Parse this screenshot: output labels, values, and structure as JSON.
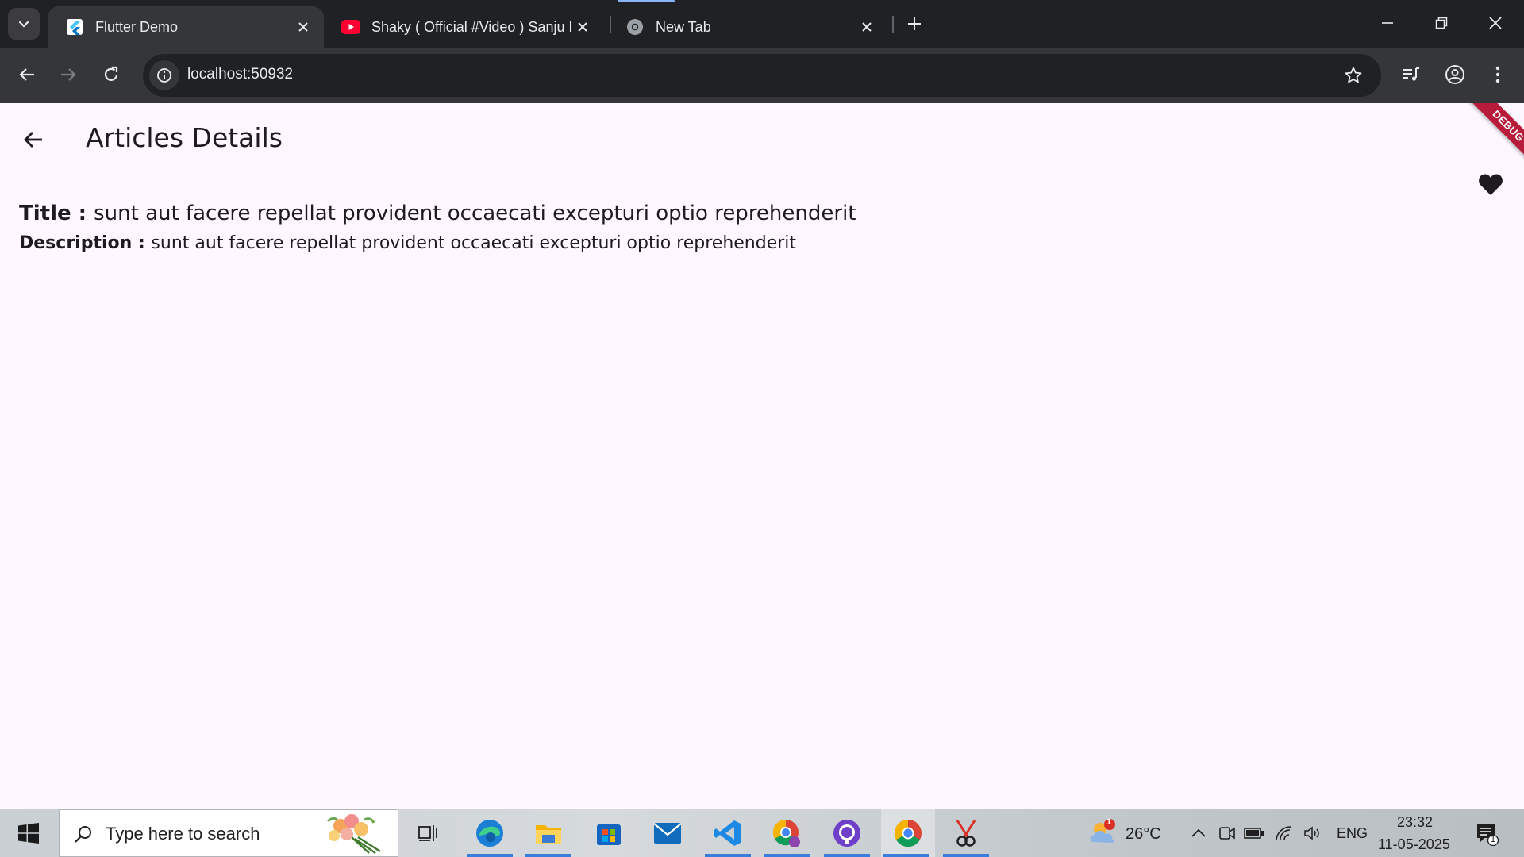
{
  "browser": {
    "tabs": [
      {
        "title": "Flutter Demo",
        "favicon": "flutter-icon",
        "active": true
      },
      {
        "title": "Shaky ( Official #Video ) Sanju R",
        "favicon": "youtube-icon",
        "active": false
      },
      {
        "title": "New Tab",
        "favicon": "chrome-icon",
        "active": false
      }
    ],
    "url": "localhost:50932",
    "colors": {
      "frame": "#202124",
      "toolbar": "#35363a",
      "text": "#e8eaed",
      "loading": "#8ab4f8"
    }
  },
  "app": {
    "appbar_title": "Articles Details",
    "debug_banner": "DEBUG",
    "title_label": "Title : ",
    "title_value": "sunt aut facere repellat provident occaecati excepturi optio reprehenderit",
    "description_label": "Description : ",
    "description_value": "sunt aut facere repellat provident occaecati excepturi optio reprehenderit",
    "favorite_icon": "heart-icon",
    "colors": {
      "background": "#fef7ff",
      "text": "#1d1b20",
      "debug": "#b71c3a"
    }
  },
  "taskbar": {
    "search_placeholder": "Type here to search",
    "apps": [
      "task-view",
      "edge",
      "file-explorer",
      "microsoft-store",
      "mail",
      "vs-code",
      "chrome-profile",
      "github-desktop",
      "chrome",
      "snipping-tool"
    ],
    "weather_temp": "26°C",
    "weather_badge": "1",
    "language": "ENG",
    "time": "23:32",
    "date": "11-05-2025",
    "notification_count": "1"
  }
}
